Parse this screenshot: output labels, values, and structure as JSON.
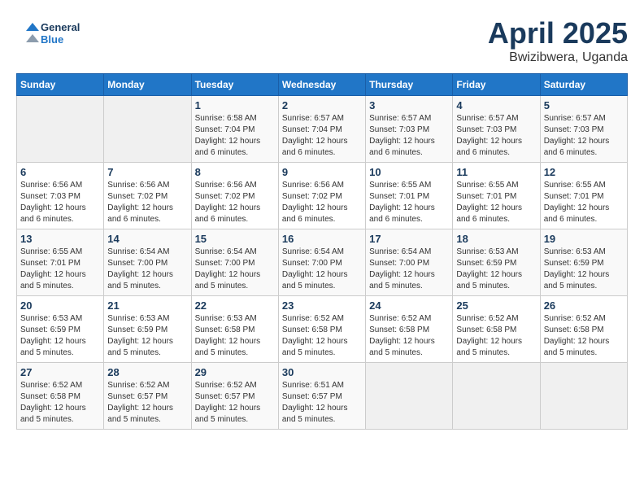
{
  "logo": {
    "line1": "General",
    "line2": "Blue"
  },
  "title": "April 2025",
  "subtitle": "Bwizibwera, Uganda",
  "days_of_week": [
    "Sunday",
    "Monday",
    "Tuesday",
    "Wednesday",
    "Thursday",
    "Friday",
    "Saturday"
  ],
  "weeks": [
    [
      {
        "day": "",
        "info": ""
      },
      {
        "day": "",
        "info": ""
      },
      {
        "day": "1",
        "info": "Sunrise: 6:58 AM\nSunset: 7:04 PM\nDaylight: 12 hours\nand 6 minutes."
      },
      {
        "day": "2",
        "info": "Sunrise: 6:57 AM\nSunset: 7:04 PM\nDaylight: 12 hours\nand 6 minutes."
      },
      {
        "day": "3",
        "info": "Sunrise: 6:57 AM\nSunset: 7:03 PM\nDaylight: 12 hours\nand 6 minutes."
      },
      {
        "day": "4",
        "info": "Sunrise: 6:57 AM\nSunset: 7:03 PM\nDaylight: 12 hours\nand 6 minutes."
      },
      {
        "day": "5",
        "info": "Sunrise: 6:57 AM\nSunset: 7:03 PM\nDaylight: 12 hours\nand 6 minutes."
      }
    ],
    [
      {
        "day": "6",
        "info": "Sunrise: 6:56 AM\nSunset: 7:03 PM\nDaylight: 12 hours\nand 6 minutes."
      },
      {
        "day": "7",
        "info": "Sunrise: 6:56 AM\nSunset: 7:02 PM\nDaylight: 12 hours\nand 6 minutes."
      },
      {
        "day": "8",
        "info": "Sunrise: 6:56 AM\nSunset: 7:02 PM\nDaylight: 12 hours\nand 6 minutes."
      },
      {
        "day": "9",
        "info": "Sunrise: 6:56 AM\nSunset: 7:02 PM\nDaylight: 12 hours\nand 6 minutes."
      },
      {
        "day": "10",
        "info": "Sunrise: 6:55 AM\nSunset: 7:01 PM\nDaylight: 12 hours\nand 6 minutes."
      },
      {
        "day": "11",
        "info": "Sunrise: 6:55 AM\nSunset: 7:01 PM\nDaylight: 12 hours\nand 6 minutes."
      },
      {
        "day": "12",
        "info": "Sunrise: 6:55 AM\nSunset: 7:01 PM\nDaylight: 12 hours\nand 6 minutes."
      }
    ],
    [
      {
        "day": "13",
        "info": "Sunrise: 6:55 AM\nSunset: 7:01 PM\nDaylight: 12 hours\nand 5 minutes."
      },
      {
        "day": "14",
        "info": "Sunrise: 6:54 AM\nSunset: 7:00 PM\nDaylight: 12 hours\nand 5 minutes."
      },
      {
        "day": "15",
        "info": "Sunrise: 6:54 AM\nSunset: 7:00 PM\nDaylight: 12 hours\nand 5 minutes."
      },
      {
        "day": "16",
        "info": "Sunrise: 6:54 AM\nSunset: 7:00 PM\nDaylight: 12 hours\nand 5 minutes."
      },
      {
        "day": "17",
        "info": "Sunrise: 6:54 AM\nSunset: 7:00 PM\nDaylight: 12 hours\nand 5 minutes."
      },
      {
        "day": "18",
        "info": "Sunrise: 6:53 AM\nSunset: 6:59 PM\nDaylight: 12 hours\nand 5 minutes."
      },
      {
        "day": "19",
        "info": "Sunrise: 6:53 AM\nSunset: 6:59 PM\nDaylight: 12 hours\nand 5 minutes."
      }
    ],
    [
      {
        "day": "20",
        "info": "Sunrise: 6:53 AM\nSunset: 6:59 PM\nDaylight: 12 hours\nand 5 minutes."
      },
      {
        "day": "21",
        "info": "Sunrise: 6:53 AM\nSunset: 6:59 PM\nDaylight: 12 hours\nand 5 minutes."
      },
      {
        "day": "22",
        "info": "Sunrise: 6:53 AM\nSunset: 6:58 PM\nDaylight: 12 hours\nand 5 minutes."
      },
      {
        "day": "23",
        "info": "Sunrise: 6:52 AM\nSunset: 6:58 PM\nDaylight: 12 hours\nand 5 minutes."
      },
      {
        "day": "24",
        "info": "Sunrise: 6:52 AM\nSunset: 6:58 PM\nDaylight: 12 hours\nand 5 minutes."
      },
      {
        "day": "25",
        "info": "Sunrise: 6:52 AM\nSunset: 6:58 PM\nDaylight: 12 hours\nand 5 minutes."
      },
      {
        "day": "26",
        "info": "Sunrise: 6:52 AM\nSunset: 6:58 PM\nDaylight: 12 hours\nand 5 minutes."
      }
    ],
    [
      {
        "day": "27",
        "info": "Sunrise: 6:52 AM\nSunset: 6:58 PM\nDaylight: 12 hours\nand 5 minutes."
      },
      {
        "day": "28",
        "info": "Sunrise: 6:52 AM\nSunset: 6:57 PM\nDaylight: 12 hours\nand 5 minutes."
      },
      {
        "day": "29",
        "info": "Sunrise: 6:52 AM\nSunset: 6:57 PM\nDaylight: 12 hours\nand 5 minutes."
      },
      {
        "day": "30",
        "info": "Sunrise: 6:51 AM\nSunset: 6:57 PM\nDaylight: 12 hours\nand 5 minutes."
      },
      {
        "day": "",
        "info": ""
      },
      {
        "day": "",
        "info": ""
      },
      {
        "day": "",
        "info": ""
      }
    ]
  ]
}
